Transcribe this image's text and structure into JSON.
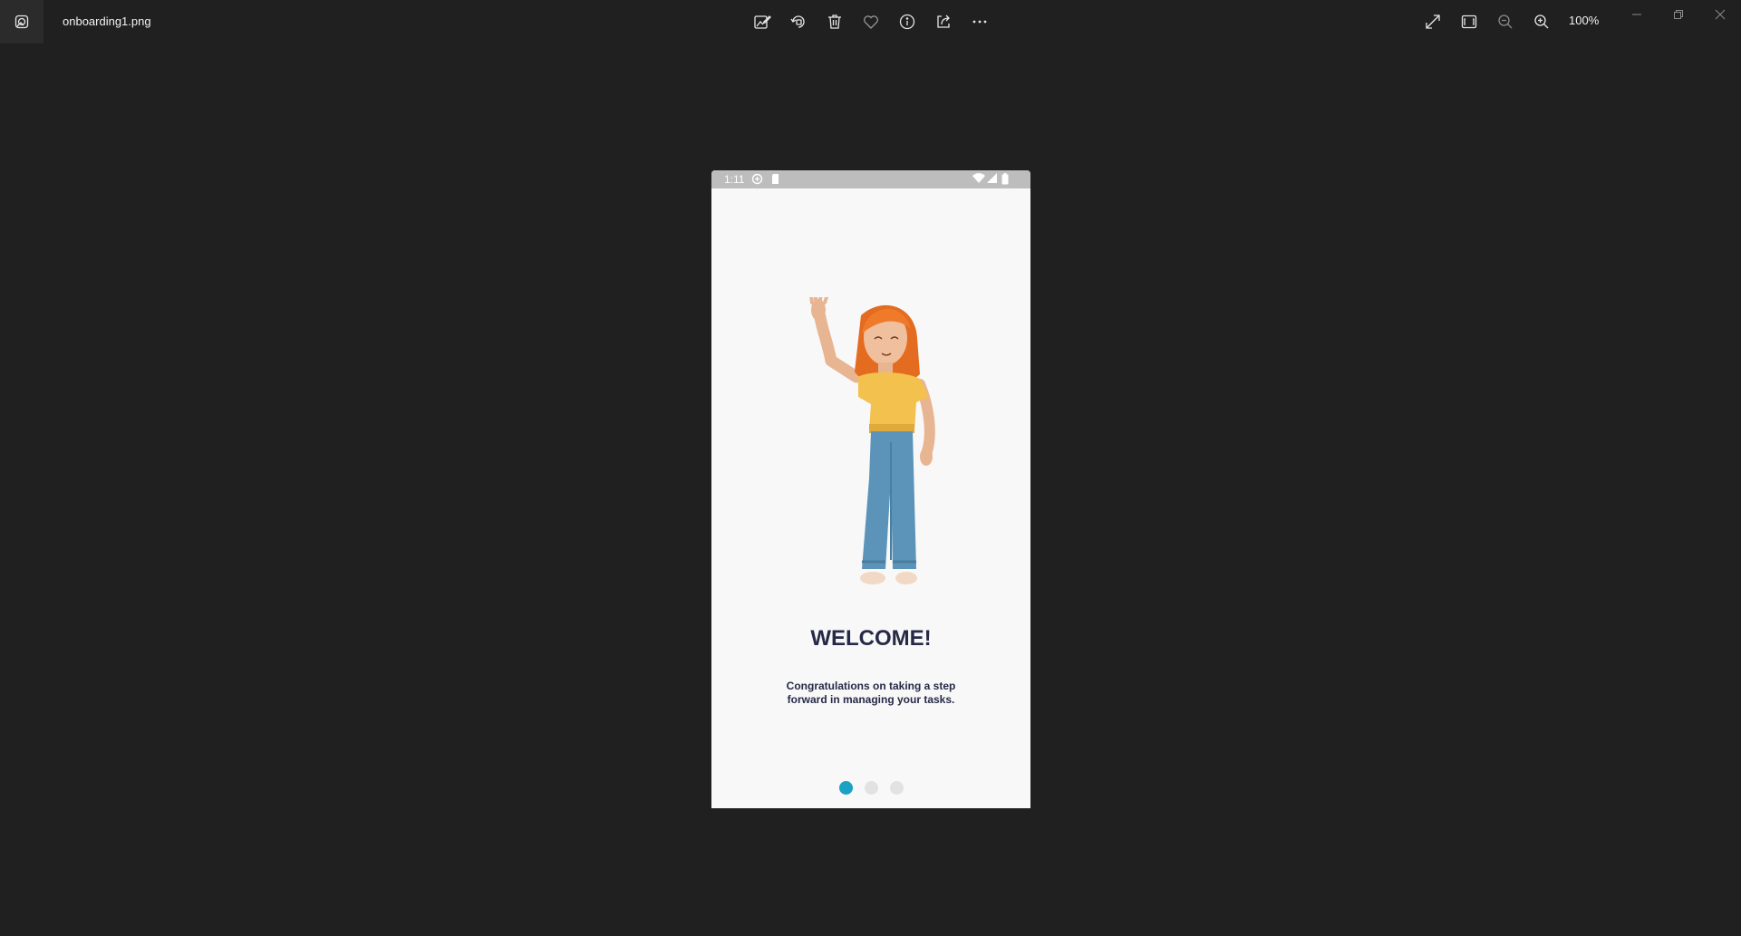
{
  "window": {
    "file_name": "onboarding1.png",
    "zoom": "100%"
  },
  "toolbar": {
    "center_tools": [
      "edit-image-icon",
      "rotate-icon",
      "delete-icon",
      "favorite-icon",
      "info-icon",
      "share-icon",
      "more-icon"
    ],
    "right_tools": [
      "expand-icon",
      "fit-to-window-icon",
      "zoom-out-icon",
      "zoom-in-icon"
    ]
  },
  "phone": {
    "status_bar": {
      "time": "1:11"
    },
    "title": "WELCOME!",
    "message_line1": "Congratulations on taking a step",
    "message_line2": "forward in managing your tasks.",
    "pager": {
      "pages": 3,
      "active": 1
    },
    "colors": {
      "accent": "#1aa1c4",
      "text": "#262a46",
      "dot_inactive": "#e2e2e2"
    }
  }
}
